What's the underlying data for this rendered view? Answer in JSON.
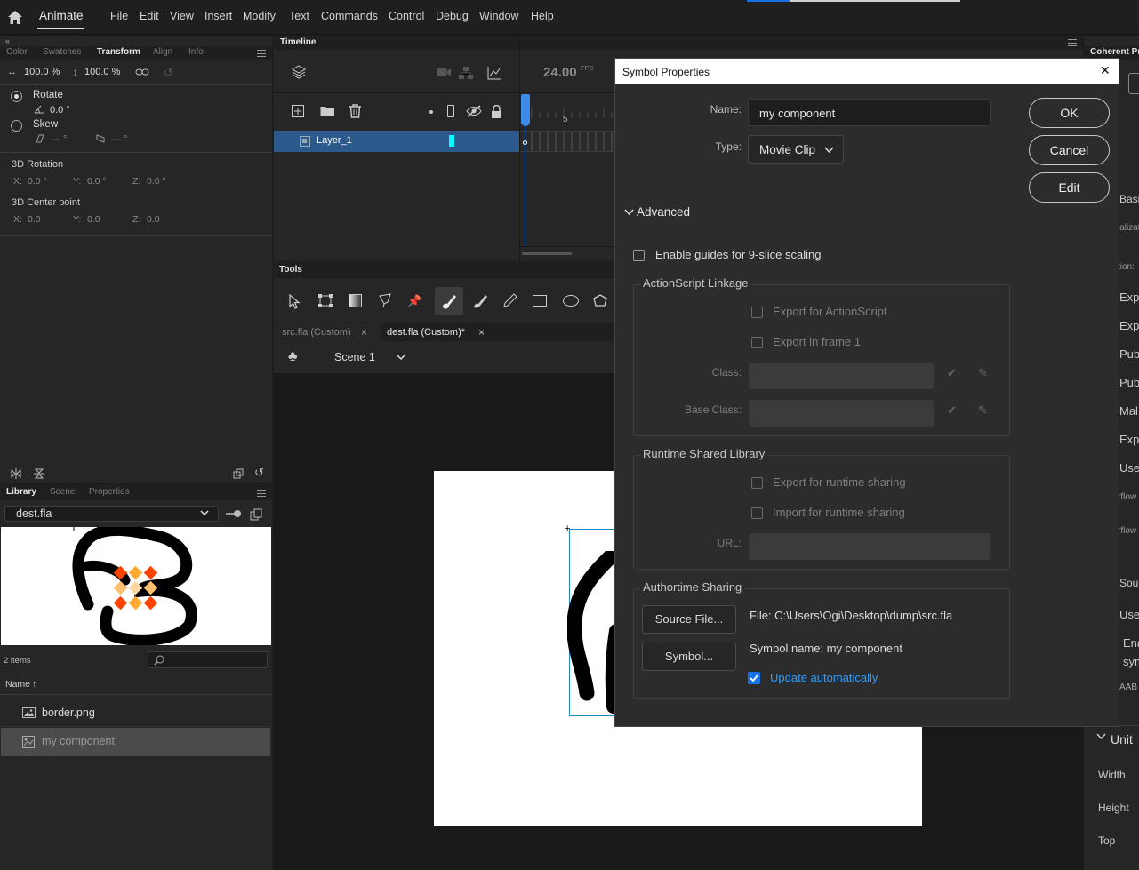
{
  "app": {
    "name": "Animate"
  },
  "menu": [
    "File",
    "Edit",
    "View",
    "Insert",
    "Modify",
    "Text",
    "Commands",
    "Control",
    "Debug",
    "Window",
    "Help"
  ],
  "transform_panel": {
    "tabs": [
      "Color",
      "Swatches",
      "Transform",
      "Align",
      "Info"
    ],
    "width_pct": "100.0 %",
    "height_pct": "100.0 %",
    "rotate_label": "Rotate",
    "rotate_value": "0.0 °",
    "skew_label": "Skew",
    "skew_h": "— °",
    "skew_v": "— °",
    "rotation3d_label": "3D Rotation",
    "rot_x_label": "X:",
    "rot_x": "0.0 °",
    "rot_y_label": "Y:",
    "rot_y": "0.0 °",
    "rot_z_label": "Z:",
    "rot_z": "0.0 °",
    "center3d_label": "3D Center point",
    "cp_x_label": "X:",
    "cp_x": "0.0",
    "cp_y_label": "Y:",
    "cp_y": "0.0",
    "cp_z_label": "Z:",
    "cp_z": "0.0"
  },
  "library_panel": {
    "tabs": [
      "Library",
      "Scene",
      "Properties"
    ],
    "document": "dest.fla",
    "item_count": "2 items",
    "name_header": "Name",
    "items": [
      {
        "name": "border.png",
        "icon": "bitmap-icon"
      },
      {
        "name": "my component",
        "icon": "movie-clip-icon"
      }
    ]
  },
  "timeline": {
    "title": "Timeline",
    "fps": "24.00",
    "fps_unit": "FPS",
    "frame_marker": "5",
    "layer": "Layer_1"
  },
  "tools": {
    "title": "Tools"
  },
  "doc_tabs": [
    {
      "label": "src.fla (Custom)",
      "close": "×"
    },
    {
      "label": "dest.fla (Custom)*",
      "close": "×"
    }
  ],
  "scene": {
    "label": "Scene 1"
  },
  "right_panel": {
    "title": "Coherent Pr",
    "labels": [
      "Basic",
      "ializat",
      "tion:",
      "Exp",
      "Exp",
      "Pub",
      "Pub",
      "Mal",
      "Exp",
      "Use",
      "rflow",
      "rflow",
      "Sour",
      "Use",
      "Ena",
      "sym",
      "AAB"
    ],
    "units_label": "Unit",
    "width_label": "Width",
    "height_label": "Height",
    "top_label": "Top"
  },
  "dialog": {
    "title": "Symbol Properties",
    "close": "✕",
    "name_label": "Name:",
    "name_value": "my component",
    "type_label": "Type:",
    "type_value": "Movie Clip",
    "ok": "OK",
    "cancel": "Cancel",
    "edit": "Edit",
    "advanced": "Advanced",
    "nine_slice": "Enable guides for 9-slice scaling",
    "as_group": "ActionScript Linkage",
    "export_as": "Export for ActionScript",
    "export_frame1": "Export in frame 1",
    "class_label": "Class:",
    "base_class_label": "Base Class:",
    "rsl_group": "Runtime Shared Library",
    "export_runtime": "Export for runtime sharing",
    "import_runtime": "Import for runtime sharing",
    "url_label": "URL:",
    "authortime_group": "Authortime Sharing",
    "source_file_btn": "Source File...",
    "symbol_btn": "Symbol...",
    "file_text": "File: C:\\Users\\Ogi\\Desktop\\dump\\src.fla",
    "symbol_name_text": "Symbol name: my component",
    "update_auto": "Update automatically",
    "update_auto_checked": true
  },
  "colors": {
    "accent": "#1473e6",
    "selection": "#2d5a8c",
    "playhead": "#3c8ce7",
    "layer_color": "#00ffff"
  }
}
